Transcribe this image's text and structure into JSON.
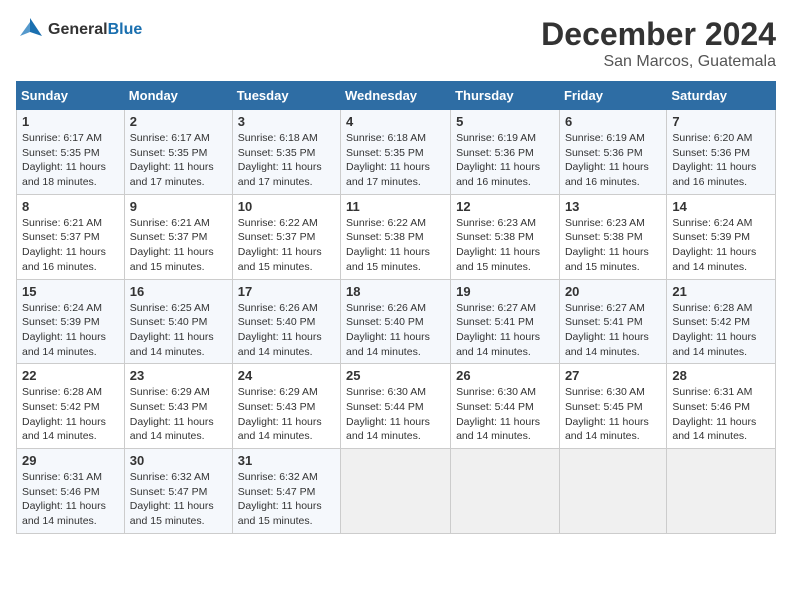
{
  "header": {
    "logo_line1": "General",
    "logo_line2": "Blue",
    "title": "December 2024",
    "subtitle": "San Marcos, Guatemala"
  },
  "columns": [
    "Sunday",
    "Monday",
    "Tuesday",
    "Wednesday",
    "Thursday",
    "Friday",
    "Saturday"
  ],
  "weeks": [
    [
      {
        "day": "1",
        "info": "Sunrise: 6:17 AM\nSunset: 5:35 PM\nDaylight: 11 hours\nand 18 minutes."
      },
      {
        "day": "2",
        "info": "Sunrise: 6:17 AM\nSunset: 5:35 PM\nDaylight: 11 hours\nand 17 minutes."
      },
      {
        "day": "3",
        "info": "Sunrise: 6:18 AM\nSunset: 5:35 PM\nDaylight: 11 hours\nand 17 minutes."
      },
      {
        "day": "4",
        "info": "Sunrise: 6:18 AM\nSunset: 5:35 PM\nDaylight: 11 hours\nand 17 minutes."
      },
      {
        "day": "5",
        "info": "Sunrise: 6:19 AM\nSunset: 5:36 PM\nDaylight: 11 hours\nand 16 minutes."
      },
      {
        "day": "6",
        "info": "Sunrise: 6:19 AM\nSunset: 5:36 PM\nDaylight: 11 hours\nand 16 minutes."
      },
      {
        "day": "7",
        "info": "Sunrise: 6:20 AM\nSunset: 5:36 PM\nDaylight: 11 hours\nand 16 minutes."
      }
    ],
    [
      {
        "day": "8",
        "info": "Sunrise: 6:21 AM\nSunset: 5:37 PM\nDaylight: 11 hours\nand 16 minutes."
      },
      {
        "day": "9",
        "info": "Sunrise: 6:21 AM\nSunset: 5:37 PM\nDaylight: 11 hours\nand 15 minutes."
      },
      {
        "day": "10",
        "info": "Sunrise: 6:22 AM\nSunset: 5:37 PM\nDaylight: 11 hours\nand 15 minutes."
      },
      {
        "day": "11",
        "info": "Sunrise: 6:22 AM\nSunset: 5:38 PM\nDaylight: 11 hours\nand 15 minutes."
      },
      {
        "day": "12",
        "info": "Sunrise: 6:23 AM\nSunset: 5:38 PM\nDaylight: 11 hours\nand 15 minutes."
      },
      {
        "day": "13",
        "info": "Sunrise: 6:23 AM\nSunset: 5:38 PM\nDaylight: 11 hours\nand 15 minutes."
      },
      {
        "day": "14",
        "info": "Sunrise: 6:24 AM\nSunset: 5:39 PM\nDaylight: 11 hours\nand 14 minutes."
      }
    ],
    [
      {
        "day": "15",
        "info": "Sunrise: 6:24 AM\nSunset: 5:39 PM\nDaylight: 11 hours\nand 14 minutes."
      },
      {
        "day": "16",
        "info": "Sunrise: 6:25 AM\nSunset: 5:40 PM\nDaylight: 11 hours\nand 14 minutes."
      },
      {
        "day": "17",
        "info": "Sunrise: 6:26 AM\nSunset: 5:40 PM\nDaylight: 11 hours\nand 14 minutes."
      },
      {
        "day": "18",
        "info": "Sunrise: 6:26 AM\nSunset: 5:40 PM\nDaylight: 11 hours\nand 14 minutes."
      },
      {
        "day": "19",
        "info": "Sunrise: 6:27 AM\nSunset: 5:41 PM\nDaylight: 11 hours\nand 14 minutes."
      },
      {
        "day": "20",
        "info": "Sunrise: 6:27 AM\nSunset: 5:41 PM\nDaylight: 11 hours\nand 14 minutes."
      },
      {
        "day": "21",
        "info": "Sunrise: 6:28 AM\nSunset: 5:42 PM\nDaylight: 11 hours\nand 14 minutes."
      }
    ],
    [
      {
        "day": "22",
        "info": "Sunrise: 6:28 AM\nSunset: 5:42 PM\nDaylight: 11 hours\nand 14 minutes."
      },
      {
        "day": "23",
        "info": "Sunrise: 6:29 AM\nSunset: 5:43 PM\nDaylight: 11 hours\nand 14 minutes."
      },
      {
        "day": "24",
        "info": "Sunrise: 6:29 AM\nSunset: 5:43 PM\nDaylight: 11 hours\nand 14 minutes."
      },
      {
        "day": "25",
        "info": "Sunrise: 6:30 AM\nSunset: 5:44 PM\nDaylight: 11 hours\nand 14 minutes."
      },
      {
        "day": "26",
        "info": "Sunrise: 6:30 AM\nSunset: 5:44 PM\nDaylight: 11 hours\nand 14 minutes."
      },
      {
        "day": "27",
        "info": "Sunrise: 6:30 AM\nSunset: 5:45 PM\nDaylight: 11 hours\nand 14 minutes."
      },
      {
        "day": "28",
        "info": "Sunrise: 6:31 AM\nSunset: 5:46 PM\nDaylight: 11 hours\nand 14 minutes."
      }
    ],
    [
      {
        "day": "29",
        "info": "Sunrise: 6:31 AM\nSunset: 5:46 PM\nDaylight: 11 hours\nand 14 minutes."
      },
      {
        "day": "30",
        "info": "Sunrise: 6:32 AM\nSunset: 5:47 PM\nDaylight: 11 hours\nand 15 minutes."
      },
      {
        "day": "31",
        "info": "Sunrise: 6:32 AM\nSunset: 5:47 PM\nDaylight: 11 hours\nand 15 minutes."
      },
      null,
      null,
      null,
      null
    ]
  ]
}
